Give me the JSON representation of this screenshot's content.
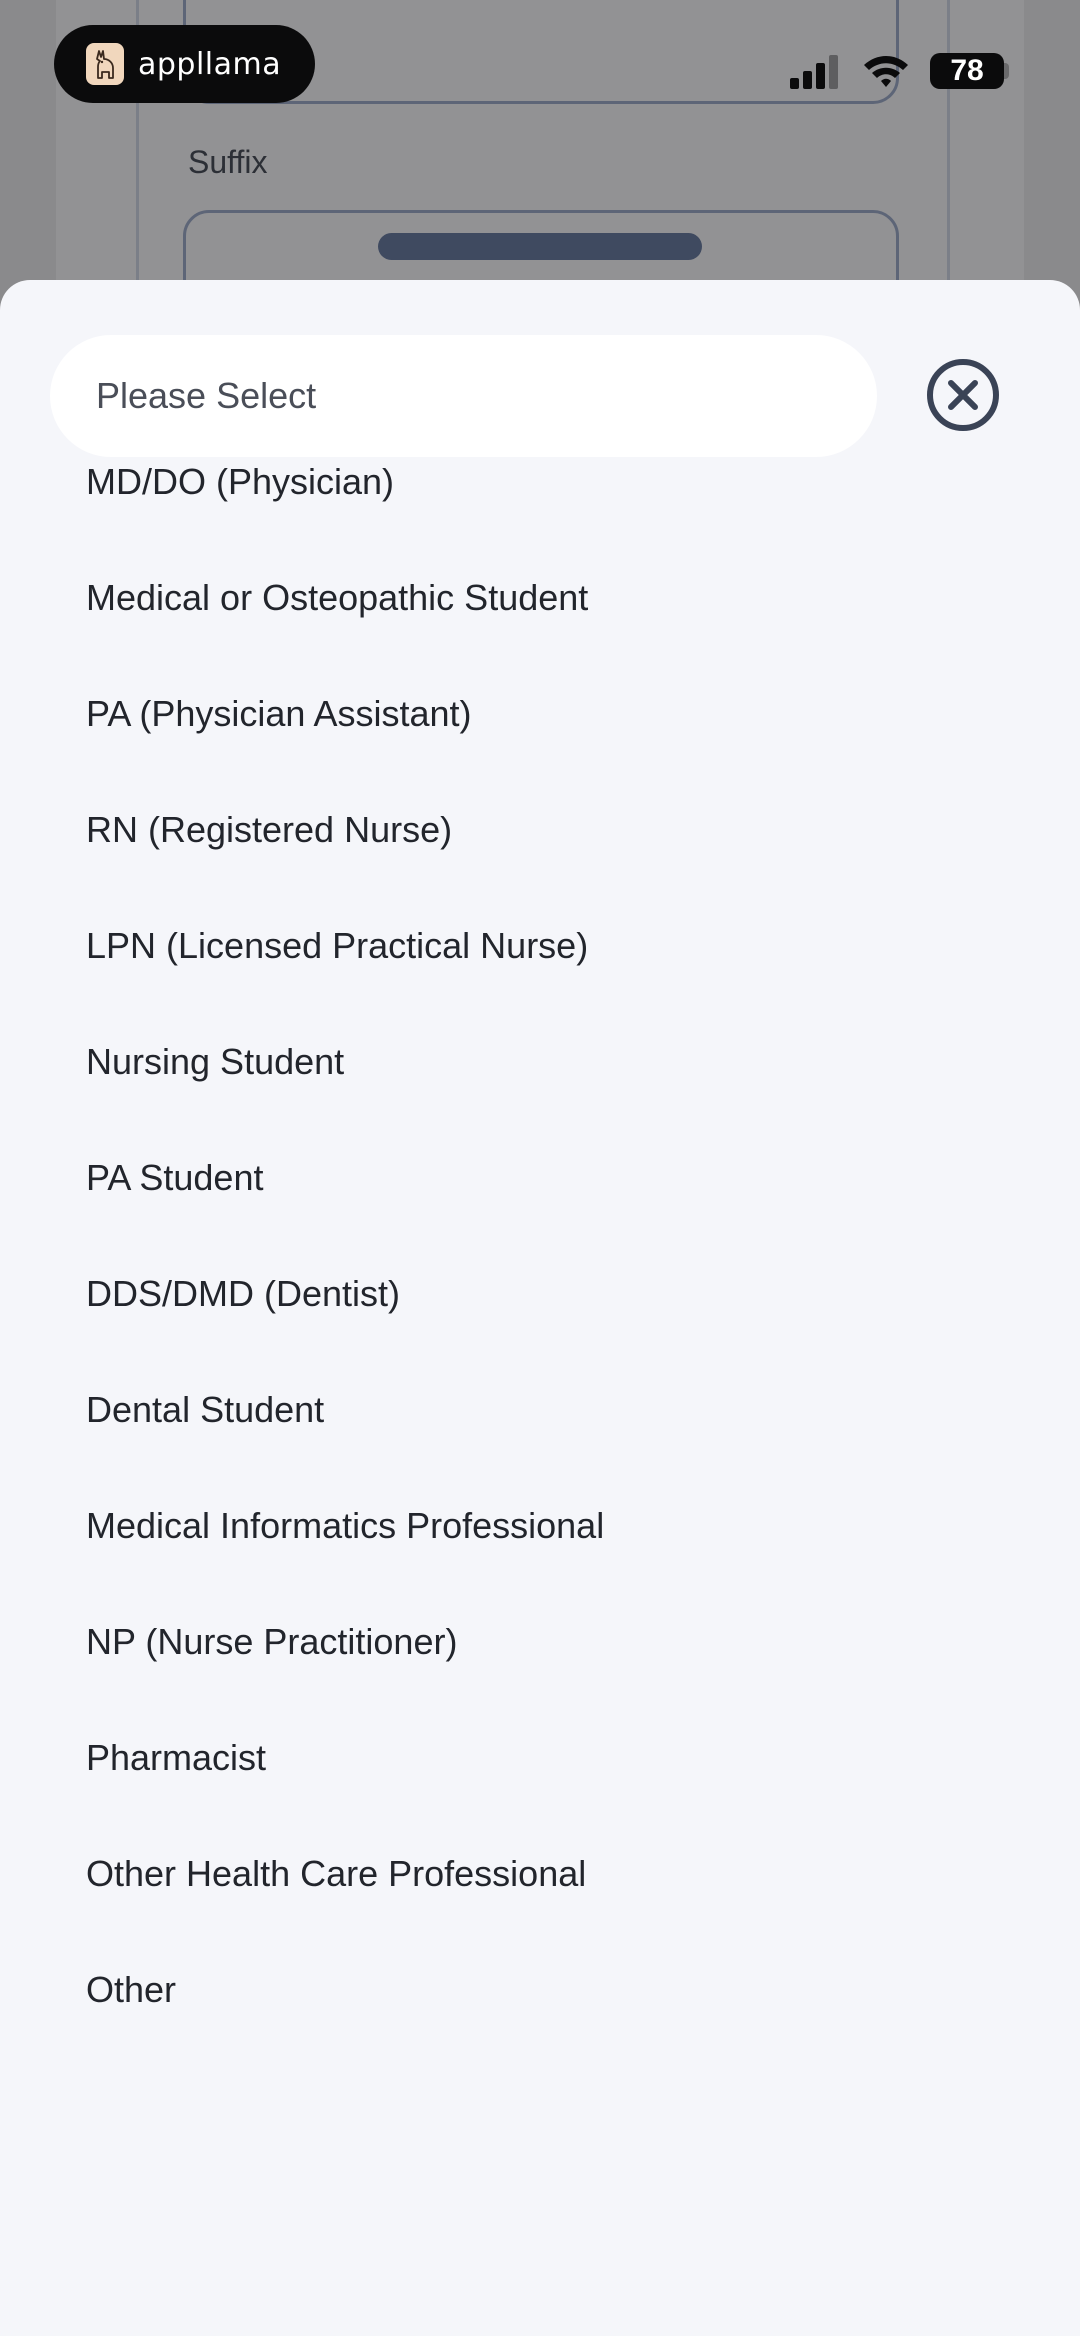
{
  "status_bar": {
    "app_name": "appllama",
    "battery_level": "78",
    "logo_icon": "llama-logo-icon",
    "signal_icon": "cellular-signal-icon",
    "wifi_icon": "wifi-icon"
  },
  "background_form": {
    "suffix_label": "Suffix"
  },
  "picker": {
    "search_placeholder": "Please Select",
    "close_icon": "close-circle-icon",
    "options": [
      "MD/DO (Physician)",
      "Medical or Osteopathic Student",
      "PA (Physician Assistant)",
      "RN (Registered Nurse)",
      "LPN (Licensed Practical Nurse)",
      "Nursing Student",
      "PA Student",
      "DDS/DMD (Dentist)",
      "Dental Student",
      "Medical Informatics Professional",
      "NP (Nurse Practitioner)",
      "Pharmacist",
      "Other Health Care Professional",
      "Other"
    ]
  },
  "colors": {
    "sheet_background": "#f5f6fa",
    "text": "#22252c",
    "close_icon": "#3a4356",
    "overlay": "#8a8a8c"
  }
}
